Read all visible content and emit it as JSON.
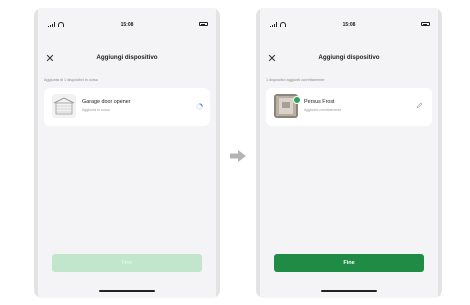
{
  "left_screen": {
    "status_time": "15:08",
    "title": "Aggiungi dispositivo",
    "section_label": "Aggiunta di 1 dispositivi in corso",
    "device": {
      "name": "Garage door opener",
      "status": "Aggiunta in corso",
      "state_icon": "loading-spinner-icon"
    },
    "done_button": "Fine"
  },
  "right_screen": {
    "status_time": "15:08",
    "title": "Aggiungi dispositivo",
    "section_label": "1 dispositivi aggiunti correttamente",
    "device": {
      "name": "Persus Frost",
      "status": "Aggiunto correttamente",
      "state_icon": "edit-pencil-icon"
    },
    "done_button": "Fine"
  },
  "colors": {
    "accent_green": "#1f8b45",
    "disabled_green": "#c2e6cc",
    "success_badge": "#2aa25a",
    "spinner_blue": "#3a7bd5"
  },
  "arrow_icon": "right-arrow-icon"
}
